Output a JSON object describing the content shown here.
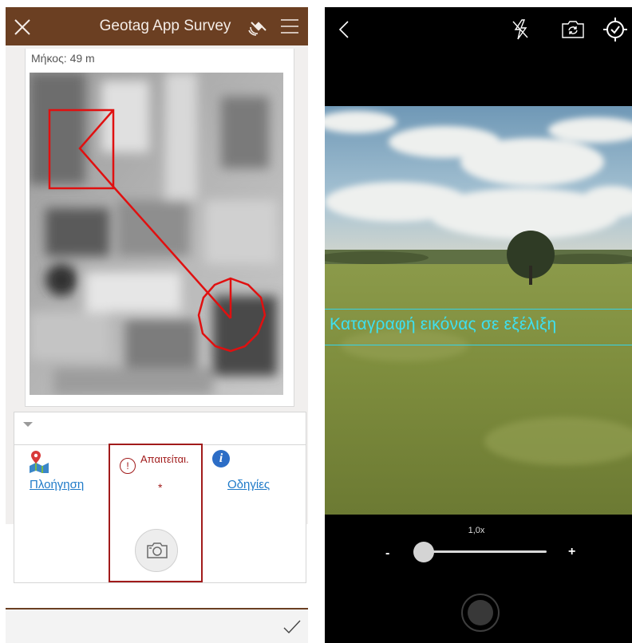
{
  "survey": {
    "title": "Geotag App Survey",
    "length_label": "Μήκος: 49 m",
    "navigation_label": "Πλοήγηση",
    "required_label": "Απαιτείται.",
    "required_star": "*",
    "instructions_label": "Οδηγίες",
    "icons": [
      "close-icon",
      "gps-satellite-icon",
      "menu-icon",
      "chevron-down-icon",
      "map-pin-icon",
      "warning-icon",
      "camera-icon",
      "info-icon",
      "checkmark-icon"
    ],
    "colors": {
      "header": "#6b3f22",
      "required": "#a11b1b",
      "link": "#1f7ac8",
      "drawing": "#e01010"
    }
  },
  "camera": {
    "overlay_text": "Καταγραφή εικόνας σε εξέλιξη",
    "zoom_label": "1,0x",
    "zoom_minus": "-",
    "zoom_plus": "+",
    "zoom_level": 0.0,
    "icons": [
      "back-icon",
      "flash-off-icon",
      "switch-camera-icon",
      "location-target-icon",
      "shutter-button"
    ],
    "colors": {
      "overlay": "#3ee0f0",
      "background": "#000000"
    }
  }
}
